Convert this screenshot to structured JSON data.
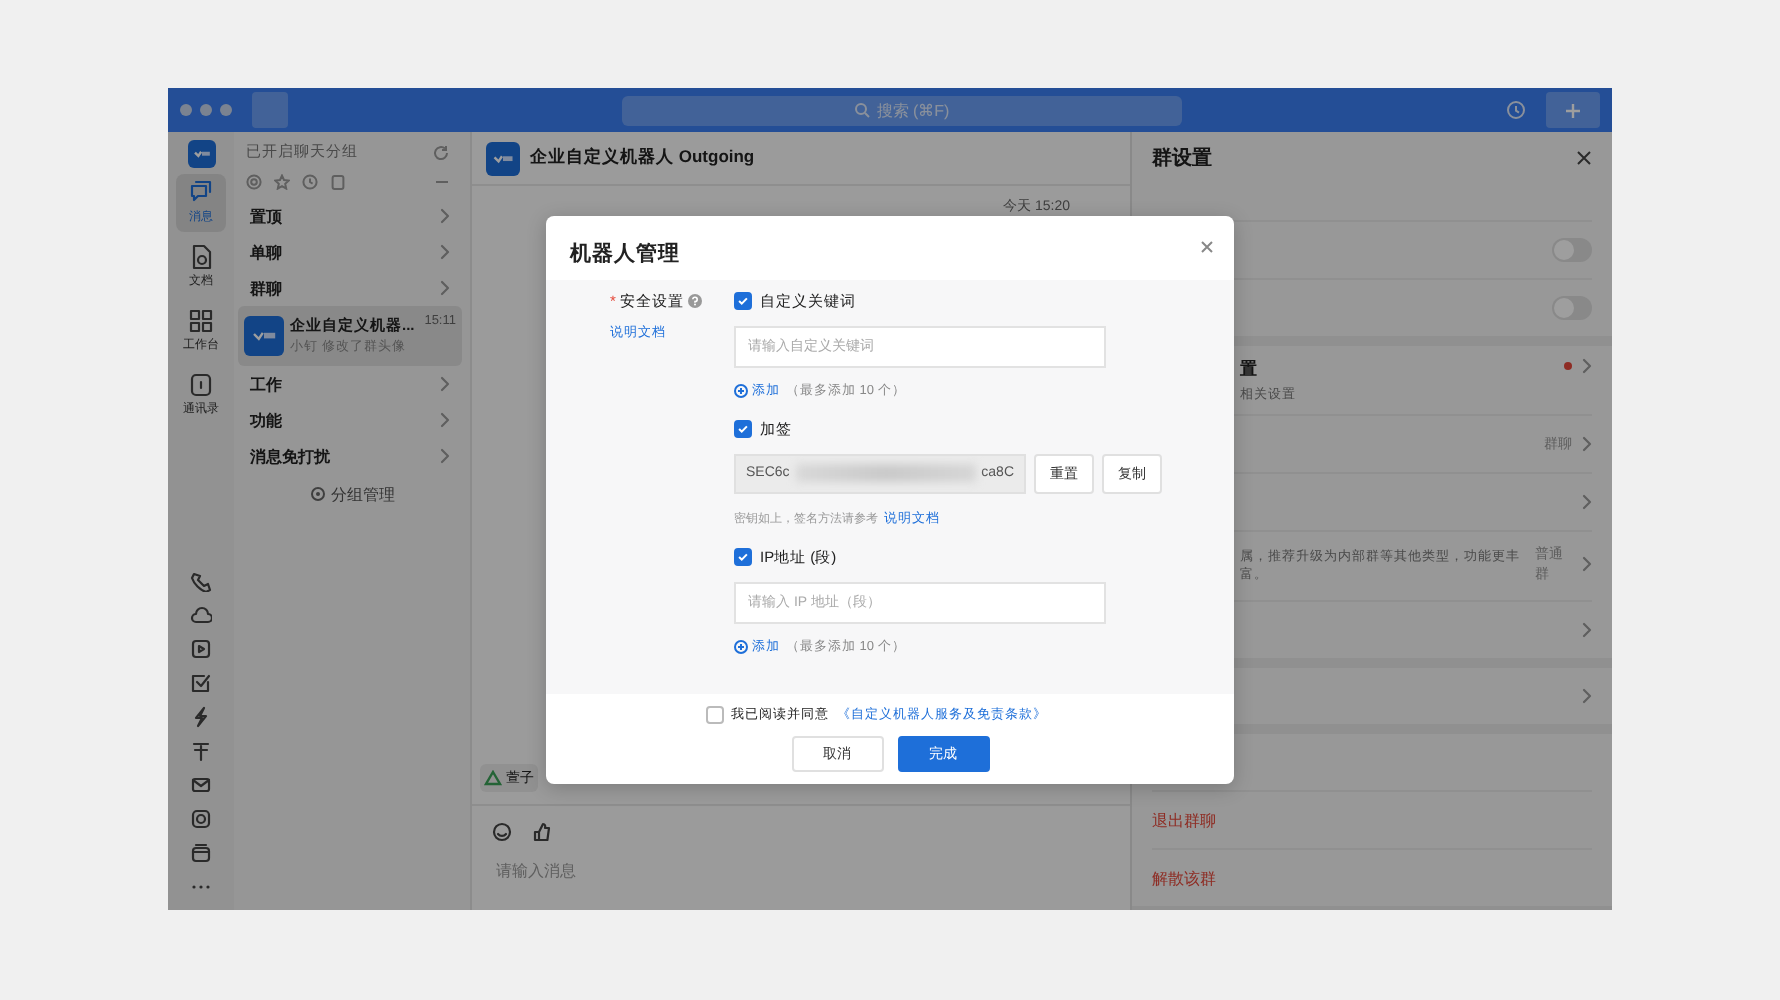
{
  "window": {
    "search": {
      "placeholder": "搜索 (⌘F)"
    }
  },
  "nav_rail": {
    "items": [
      {
        "label": "消息",
        "selected": true
      },
      {
        "label": "文档",
        "selected": false
      },
      {
        "label": "工作台",
        "selected": false
      },
      {
        "label": "通讯录",
        "selected": false
      }
    ]
  },
  "chat_list": {
    "header": "已开启聊天分组",
    "groups": [
      {
        "label": "置顶"
      },
      {
        "label": "单聊"
      },
      {
        "label": "群聊",
        "chats": [
          {
            "name": "企业自定义机器...",
            "preview": "小钉 修改了群头像",
            "time": "15:11",
            "selected": true
          }
        ]
      },
      {
        "label": "工作"
      },
      {
        "label": "功能"
      },
      {
        "label": "消息免打扰"
      }
    ],
    "manage_button": "分组管理"
  },
  "conversation": {
    "title": "企业自定义机器人 Outgoing",
    "timestamp": "今天 15:20",
    "tag": "萱子",
    "input": {
      "placeholder": "请输入消息"
    }
  },
  "group_settings": {
    "title": "群设置",
    "sections": [
      [
        {
          "kind": "plain"
        },
        {
          "kind": "toggle",
          "on": false
        },
        {
          "kind": "toggle",
          "on": false
        }
      ],
      [
        {
          "kind": "covered",
          "label": "置",
          "sub": "相关设置",
          "dot": true
        },
        {
          "kind": "link",
          "value": "群聊"
        },
        {
          "kind": "link"
        },
        {
          "kind": "covered",
          "value": "普通群",
          "sub": "属，推荐升级为内部群等其他类型，功能更丰富。"
        },
        {
          "kind": "link"
        }
      ],
      [
        {
          "kind": "link"
        }
      ],
      [
        {
          "kind": "danger"
        },
        {
          "kind": "danger",
          "label": "退出群聊"
        },
        {
          "kind": "danger",
          "label": "解散该群"
        }
      ]
    ]
  },
  "dialog": {
    "title": "机器人管理",
    "security": {
      "required_mark": "*",
      "label": "安全设置",
      "help_link": "说明文档",
      "options": [
        {
          "kind": "keywords",
          "label": "自定义关键词",
          "checked": true,
          "placeholder": "请输入自定义关键词",
          "add": "添加",
          "add_hint": "（最多添加 10 个）"
        },
        {
          "kind": "sign",
          "label": "加签",
          "checked": true,
          "secret_start": "SEC6c",
          "secret_end": "ca8C",
          "buttons": [
            "重置",
            "复制"
          ],
          "hint": "密钥如上，签名方法请参考",
          "hint_link": "说明文档"
        },
        {
          "kind": "ip",
          "label": "IP地址 (段)",
          "checked": true,
          "placeholder": "请输入 IP 地址（段）",
          "add": "添加",
          "add_hint": "（最多添加 10 个）"
        }
      ]
    },
    "agreement": {
      "checked": false,
      "text": "我已阅读并同意",
      "link": "《自定义机器人服务及免责条款》"
    },
    "buttons": [
      {
        "label": "取消",
        "kind": "secondary"
      },
      {
        "label": "完成",
        "kind": "primary"
      }
    ]
  }
}
